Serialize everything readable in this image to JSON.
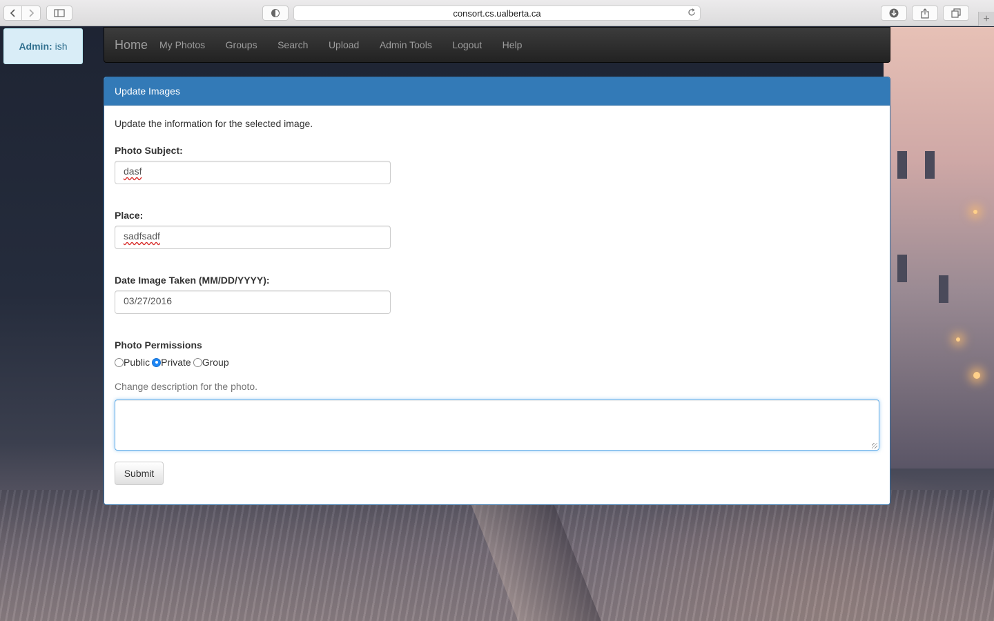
{
  "browser": {
    "url": "consort.cs.ualberta.ca",
    "new_tab": "+"
  },
  "admin": {
    "role_label": "Admin:",
    "username": "ish"
  },
  "navbar": {
    "brand": "Home",
    "links": [
      "My Photos",
      "Groups",
      "Search",
      "Upload",
      "Admin Tools",
      "Logout",
      "Help"
    ]
  },
  "panel": {
    "title": "Update Images",
    "intro": "Update the information for the selected image.",
    "subject": {
      "label": "Photo Subject:",
      "value": "dasf"
    },
    "place": {
      "label": "Place:",
      "value": "sadfsadf"
    },
    "date": {
      "label": "Date Image Taken (MM/DD/YYYY):",
      "value": "03/27/2016"
    },
    "permissions": {
      "label": "Photo Permissions",
      "options": [
        "Public",
        "Private",
        "Group"
      ],
      "selected": "Private"
    },
    "description_help": "Change description for the photo.",
    "description_value": "",
    "submit_label": "Submit"
  },
  "colors": {
    "panel_header": "#337ab7",
    "navbar": "#222222",
    "admin_badge_bg": "#d9edf7",
    "radio_selected": "#1f87f5"
  }
}
